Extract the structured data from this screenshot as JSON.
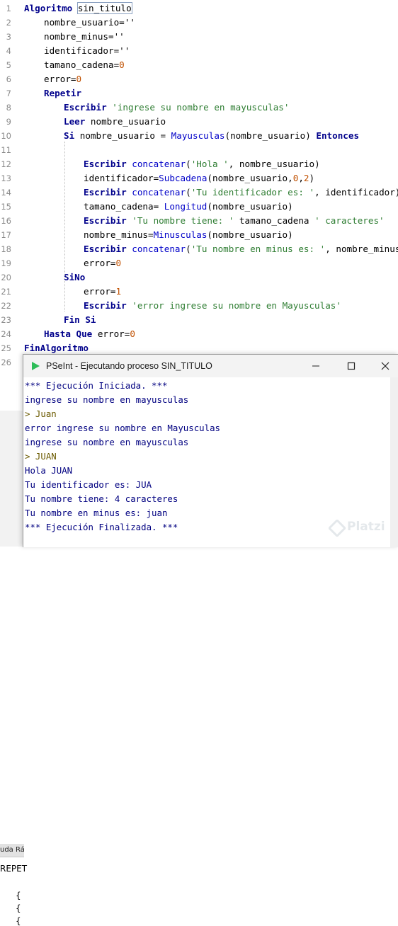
{
  "editor": {
    "line_numbers": [
      "1",
      "2",
      "3",
      "4",
      "5",
      "6",
      "7",
      "8",
      "9",
      "10",
      "11",
      "12",
      "13",
      "14",
      "15",
      "16",
      "17",
      "18",
      "19",
      "20",
      "21",
      "22",
      "23",
      "24",
      "25",
      "26"
    ],
    "lines": [
      [
        {
          "t": "Algoritmo",
          "c": "kw"
        },
        {
          "t": " "
        },
        {
          "t": "sin_titulo",
          "c": "boxed"
        }
      ],
      [
        {
          "t": "nombre_usuario=''"
        }
      ],
      [
        {
          "t": "nombre_minus=''"
        }
      ],
      [
        {
          "t": "identificador=''"
        }
      ],
      [
        {
          "t": "tamano_cadena="
        },
        {
          "t": "0",
          "c": "num"
        }
      ],
      [
        {
          "t": "error="
        },
        {
          "t": "0",
          "c": "num"
        }
      ],
      [
        {
          "t": "Repetir",
          "c": "kw"
        }
      ],
      [
        {
          "t": "Escribir",
          "c": "kw"
        },
        {
          "t": " "
        },
        {
          "t": "'ingrese su nombre en mayusculas'",
          "c": "str"
        }
      ],
      [
        {
          "t": "Leer",
          "c": "kw"
        },
        {
          "t": " nombre_usuario"
        }
      ],
      [
        {
          "t": "Si",
          "c": "kw"
        },
        {
          "t": " nombre_usuario = "
        },
        {
          "t": "Mayusculas",
          "c": "fn"
        },
        {
          "t": "(nombre_usuario) "
        },
        {
          "t": "Entonces",
          "c": "kw"
        }
      ],
      [],
      [
        {
          "t": "Escribir",
          "c": "kw"
        },
        {
          "t": " "
        },
        {
          "t": "concatenar",
          "c": "fn"
        },
        {
          "t": "("
        },
        {
          "t": "'Hola '",
          "c": "str"
        },
        {
          "t": ", nombre_usuario)"
        }
      ],
      [
        {
          "t": "identificador="
        },
        {
          "t": "Subcadena",
          "c": "fn"
        },
        {
          "t": "(nombre_usuario,"
        },
        {
          "t": "0",
          "c": "num"
        },
        {
          "t": ","
        },
        {
          "t": "2",
          "c": "num"
        },
        {
          "t": ")"
        }
      ],
      [
        {
          "t": "Escribir",
          "c": "kw"
        },
        {
          "t": " "
        },
        {
          "t": "concatenar",
          "c": "fn"
        },
        {
          "t": "("
        },
        {
          "t": "'Tu identificador es: '",
          "c": "str"
        },
        {
          "t": ", identificador)"
        }
      ],
      [
        {
          "t": "tamano_cadena= "
        },
        {
          "t": "Longitud",
          "c": "fn"
        },
        {
          "t": "(nombre_usuario)"
        }
      ],
      [
        {
          "t": "Escribir",
          "c": "kw"
        },
        {
          "t": " "
        },
        {
          "t": "'Tu nombre tiene: '",
          "c": "str"
        },
        {
          "t": " tamano_cadena "
        },
        {
          "t": "' caracteres'",
          "c": "str"
        }
      ],
      [
        {
          "t": "nombre_minus="
        },
        {
          "t": "Minusculas",
          "c": "fn"
        },
        {
          "t": "(nombre_usuario)"
        }
      ],
      [
        {
          "t": "Escribir",
          "c": "kw"
        },
        {
          "t": " "
        },
        {
          "t": "concatenar",
          "c": "fn"
        },
        {
          "t": "("
        },
        {
          "t": "'Tu nombre en minus es: '",
          "c": "str"
        },
        {
          "t": ", nombre_minus)"
        }
      ],
      [
        {
          "t": "error="
        },
        {
          "t": "0",
          "c": "num"
        }
      ],
      [
        {
          "t": "SiNo",
          "c": "kw"
        }
      ],
      [
        {
          "t": "error="
        },
        {
          "t": "1",
          "c": "num"
        }
      ],
      [
        {
          "t": "Escribir",
          "c": "kw"
        },
        {
          "t": " "
        },
        {
          "t": "'error ingrese su nombre en Mayusculas'",
          "c": "str"
        }
      ],
      [
        {
          "t": "Fin Si",
          "c": "kw"
        }
      ],
      [
        {
          "t": "Hasta Que",
          "c": "kw"
        },
        {
          "t": " error="
        },
        {
          "t": "0",
          "c": "num"
        }
      ],
      [
        {
          "t": "FinAlgoritmo",
          "c": "kw"
        }
      ],
      []
    ],
    "indent_levels": [
      0,
      1,
      1,
      1,
      1,
      1,
      1,
      2,
      2,
      2,
      3,
      3,
      3,
      3,
      3,
      3,
      3,
      3,
      3,
      2,
      3,
      3,
      2,
      1,
      0,
      0
    ]
  },
  "background_panel": {
    "tab_label": "uda Rá",
    "texts": [
      "REPET",
      "{",
      "{",
      "{"
    ]
  },
  "run_window": {
    "title": "PSeInt - Ejecutando proceso SIN_TITULO",
    "buttons": {
      "minimize": "minimize-icon",
      "maximize": "maximize-icon",
      "close": "close-icon"
    },
    "console": [
      {
        "text": "*** Ejecución Iniciada. ***",
        "kind": "out"
      },
      {
        "text": "ingrese su nombre en mayusculas",
        "kind": "out"
      },
      {
        "text": "> Juan",
        "kind": "input"
      },
      {
        "text": "error ingrese su nombre en Mayusculas",
        "kind": "out"
      },
      {
        "text": "ingrese su nombre en mayusculas",
        "kind": "out"
      },
      {
        "text": "> JUAN",
        "kind": "input"
      },
      {
        "text": "Hola JUAN",
        "kind": "out"
      },
      {
        "text": "Tu identificador es: JUA",
        "kind": "out"
      },
      {
        "text": "Tu nombre tiene: 4 caracteres",
        "kind": "out"
      },
      {
        "text": "Tu nombre en minus es: juan",
        "kind": "out"
      },
      {
        "text": "*** Ejecución Finalizada. ***",
        "kind": "out"
      }
    ]
  },
  "watermark": {
    "text": "Platzi"
  },
  "colors": {
    "keyword": "#00008b",
    "string": "#2e7d32",
    "number": "#c05000",
    "function": "#0000c8",
    "console_text": "#000080",
    "console_input": "#6b5a00",
    "app_icon": "#2ebd59"
  }
}
